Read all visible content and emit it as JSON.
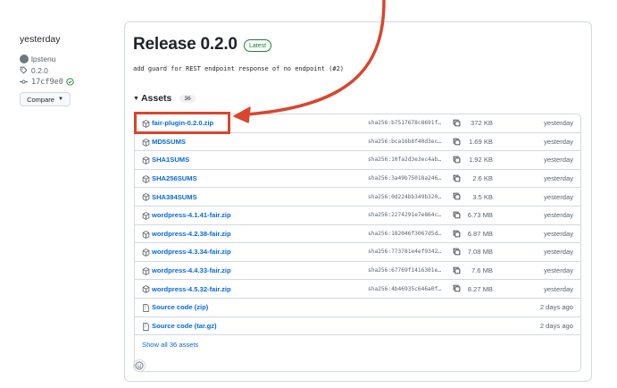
{
  "meta": {
    "when": "yesterday",
    "author": "lpstenu",
    "tag": "0.2.0",
    "commit": "17cf9e0",
    "compare_label": "Compare"
  },
  "release": {
    "title": "Release 0.2.0",
    "badge": "Latest",
    "commit_message": "add guard for REST endpoint response of no endpoint (#2)"
  },
  "assets": {
    "label": "Assets",
    "count": "36",
    "items": [
      {
        "name": "fair-plugin-0.2.0.zip",
        "hash": "sha256:b7517678c8691f…",
        "size": "372 KB",
        "date": "yesterday",
        "icon": "package-icon"
      },
      {
        "name": "MD5SUMS",
        "hash": "sha256:bca16b8f40d3ec…",
        "size": "1.69 KB",
        "date": "yesterday",
        "icon": "package-icon"
      },
      {
        "name": "SHA1SUMS",
        "hash": "sha256:10fa2d3e3ec4ab…",
        "size": "1.92 KB",
        "date": "yesterday",
        "icon": "package-icon"
      },
      {
        "name": "SHA256SUMS",
        "hash": "sha256:3a49b75018a246…",
        "size": "2.6 KB",
        "date": "yesterday",
        "icon": "package-icon"
      },
      {
        "name": "SHA384SUMS",
        "hash": "sha256:0d224bb349b320…",
        "size": "3.5 KB",
        "date": "yesterday",
        "icon": "package-icon"
      },
      {
        "name": "wordpress-4.1.41-fair.zip",
        "hash": "sha256:2274291e7e864c…",
        "size": "6.73 MB",
        "date": "yesterday",
        "icon": "package-icon"
      },
      {
        "name": "wordpress-4.2.38-fair.zip",
        "hash": "sha256:182046f3067d5d…",
        "size": "6.87 MB",
        "date": "yesterday",
        "icon": "package-icon"
      },
      {
        "name": "wordpress-4.3.34-fair.zip",
        "hash": "sha256:773781e4ef9342…",
        "size": "7.08 MB",
        "date": "yesterday",
        "icon": "package-icon"
      },
      {
        "name": "wordpress-4.4.33-fair.zip",
        "hash": "sha256:67769f1416301e…",
        "size": "7.6 MB",
        "date": "yesterday",
        "icon": "package-icon"
      },
      {
        "name": "wordpress-4.5.32-fair.zip",
        "hash": "sha256:4b46935c646a0f…",
        "size": "8.27 MB",
        "date": "yesterday",
        "icon": "package-icon"
      },
      {
        "name": "Source code (zip)",
        "hash": "",
        "size": "",
        "date": "2 days ago",
        "icon": "file-zip-icon"
      },
      {
        "name": "Source code (tar.gz)",
        "hash": "",
        "size": "",
        "date": "2 days ago",
        "icon": "file-zip-icon"
      }
    ],
    "show_all": "Show all 36 assets"
  },
  "colors": {
    "link": "#0969da",
    "badge_green": "#1a7f37",
    "annotation_red": "#d9462e",
    "border": "#d1d9e0"
  }
}
